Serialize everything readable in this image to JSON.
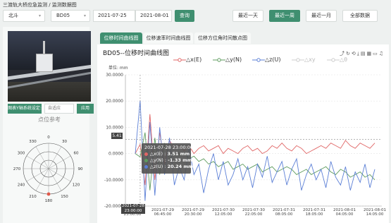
{
  "breadcrumb": "三渡轨大桥应急监测 / 监测数据图",
  "filters": {
    "region": "北斗",
    "point": "BD05",
    "start_date": "2021-07-25",
    "end_date": "2021-08-01",
    "query_label": "查询",
    "quick_ranges": [
      "最近一天",
      "最近一周",
      "最近一月",
      "全部数据"
    ],
    "active_range": "最近一周"
  },
  "left": {
    "config_label": "图表Y轴系统设定:",
    "config_placeholder": "自适应",
    "apply_label": "应用",
    "ref_title": "点位参考",
    "polar_labels": [
      "0",
      "30",
      "60",
      "90",
      "120",
      "150",
      "180",
      "210",
      "240",
      "270",
      "300",
      "330"
    ]
  },
  "tabs": [
    "位移时间曲线图",
    "位移速率时间曲线图",
    "位移方位角时间散点图"
  ],
  "active_tab": "位移时间曲线图",
  "chart_title": "BD05--位移时间曲线图",
  "toolbar_icons": [
    "line-icon",
    "refresh-icon",
    "restore-icon",
    "download-icon",
    "data-view-icon",
    "chart-icon",
    "bar-icon",
    "alarm-icon"
  ],
  "legend": [
    {
      "name": "△x(E)",
      "color": "#e06666",
      "active": true
    },
    {
      "name": "△y(N)",
      "color": "#5d9b5d",
      "active": true
    },
    {
      "name": "△z(U)",
      "color": "#5b7fd6",
      "active": true
    },
    {
      "name": "△xy",
      "color": "#9ab0c8",
      "active": false
    },
    {
      "name": "△θ",
      "color": "#e6b0b0",
      "active": false
    }
  ],
  "unit_label": "单位:    mm",
  "tooltip": {
    "time": "2021-07-28 23:00:00",
    "rows": [
      {
        "label": "△x(E)  :",
        "value": "3.51 mm",
        "color": "#e06666"
      },
      {
        "label": "△y(N)  :",
        "value": "-1.33 mm",
        "color": "#5d9b5d"
      },
      {
        "label": "△z(U)  :",
        "value": "20.24 mm",
        "color": "#5b7fd6"
      }
    ]
  },
  "pointer_y_badge": "5.41",
  "pointer_x_badge": "2021-07-28 23:00:00",
  "chart_data": {
    "type": "line",
    "ylabel": "单位: mm",
    "ylim": [
      -20,
      30
    ],
    "yticks": [
      "30.0000",
      "20.0000",
      "10.0000",
      "0.0000",
      "-10.0000",
      "-20.0000"
    ],
    "xticks": [
      "2021-07-28 23:00:00",
      "2021-07-29 06:45:00",
      "2021-07-29 20:30:00",
      "2021-07-30 12:05:00",
      "2021-07-30 22:05:00",
      "2021-07-31 08:05:00",
      "2021-07-31 18:05:00",
      "2021-08-01 04:05:00",
      "2021-08-01 14:05:00"
    ],
    "series": [
      {
        "name": "△x(E)",
        "values": [
          0,
          3.5,
          -12,
          15,
          -10,
          8,
          -4,
          5,
          2,
          3,
          1,
          3,
          0,
          2,
          3,
          1,
          2,
          3,
          0,
          2,
          1,
          0,
          2,
          3,
          1,
          2,
          0,
          1,
          3,
          2,
          4,
          2,
          1,
          3,
          2,
          0,
          1,
          2,
          3,
          2,
          4,
          3,
          2,
          5,
          3,
          2,
          4,
          3,
          2,
          4
        ]
      },
      {
        "name": "△y(N)",
        "values": [
          0,
          -1.3,
          8,
          -14,
          6,
          -8,
          4,
          -2,
          0,
          -1,
          0,
          -2,
          -1,
          -3,
          -2,
          -4,
          -3,
          -5,
          -4,
          -3,
          -6,
          -5,
          -4,
          -6,
          -5,
          -4,
          -7,
          -6,
          -5,
          -7,
          -6,
          -5,
          -6,
          -8,
          -7,
          -6,
          -8,
          -7,
          -6,
          -5,
          -7,
          -8,
          -6,
          -7,
          -9,
          -8,
          -7,
          -9,
          -8,
          -10
        ]
      },
      {
        "name": "△z(U)",
        "values": [
          0,
          20.2,
          -18,
          12,
          -16,
          10,
          -8,
          6,
          -12,
          -5,
          -10,
          2,
          -8,
          -4,
          -15,
          -6,
          0,
          -10,
          -3,
          -12,
          -8,
          -2,
          -10,
          -5,
          -13,
          -4,
          -9,
          -1,
          -11,
          -7,
          -3,
          -12,
          -6,
          -2,
          -14,
          -8,
          -4,
          -10,
          -6,
          -13,
          -3,
          -9,
          -12,
          -5,
          -14,
          -7,
          -11,
          -4,
          -13,
          -6
        ]
      }
    ]
  }
}
